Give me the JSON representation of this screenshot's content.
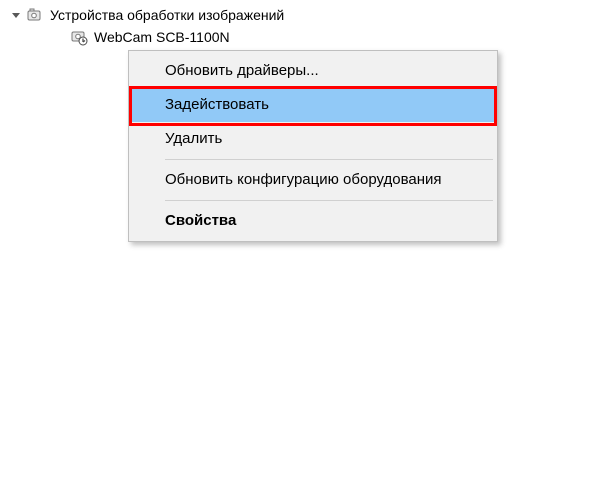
{
  "tree": {
    "category_label": "Устройства обработки изображений",
    "device_label": "WebCam SCB-1100N"
  },
  "menu": {
    "update_drivers": "Обновить драйверы...",
    "enable": "Задействовать",
    "delete": "Удалить",
    "scan_hardware": "Обновить конфигурацию оборудования",
    "properties": "Свойства"
  }
}
